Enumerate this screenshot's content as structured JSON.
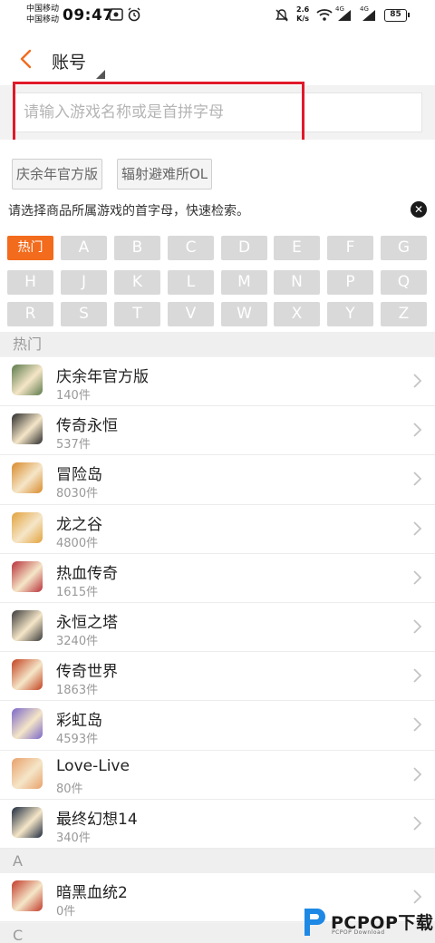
{
  "status_bar": {
    "carrier1": "中国移动",
    "carrier2": "中国移动",
    "time": "09:47",
    "net_speed_value": "2.6",
    "net_speed_unit": "K/s",
    "battery": "85",
    "signal1_label": "4G",
    "signal2_label": "4G"
  },
  "header": {
    "title": "账号"
  },
  "search": {
    "placeholder": "请输入游戏名称或是首拼字母",
    "value": ""
  },
  "recent_chips": [
    "庆余年官方版",
    "辐射避难所OL"
  ],
  "hint": "请选择商品所属游戏的首字母，快速检索。",
  "alphabet": {
    "row1": [
      "热门",
      "A",
      "B",
      "C",
      "D",
      "E",
      "F",
      "G"
    ],
    "row2": [
      "H",
      "J",
      "K",
      "L",
      "M",
      "N",
      "P",
      "Q"
    ],
    "row3": [
      "R",
      "S",
      "T",
      "V",
      "W",
      "X",
      "Y",
      "Z"
    ]
  },
  "sections": {
    "hot": "热门",
    "a": "A",
    "c": "C"
  },
  "hot_games": [
    {
      "name": "庆余年官方版",
      "count": "140件",
      "icon": "qingyunian-icon",
      "color": "#5b7a4a"
    },
    {
      "name": "传奇永恒",
      "count": "537件",
      "icon": "chuanqi-yongheng-icon",
      "color": "#2b2b2b"
    },
    {
      "name": "冒险岛",
      "count": "8030件",
      "icon": "maoxiandao-icon",
      "color": "#d88a2b"
    },
    {
      "name": "龙之谷",
      "count": "4800件",
      "icon": "longzhigu-icon",
      "color": "#e2a23c"
    },
    {
      "name": "热血传奇",
      "count": "1615件",
      "icon": "rexue-chuanqi-icon",
      "color": "#b8303a"
    },
    {
      "name": "永恒之塔",
      "count": "3240件",
      "icon": "yongheng-zhita-icon",
      "color": "#3a3a3a"
    },
    {
      "name": "传奇世界",
      "count": "1863件",
      "icon": "chuanqi-shijie-icon",
      "color": "#c2411f"
    },
    {
      "name": "彩虹岛",
      "count": "4593件",
      "icon": "caihongdao-icon",
      "color": "#7a66c9"
    },
    {
      "name": "Love-Live",
      "count": "80件",
      "icon": "love-live-icon",
      "color": "#e8a06a"
    },
    {
      "name": "最终幻想14",
      "count": "340件",
      "icon": "ff14-icon",
      "color": "#1d2a3f"
    }
  ],
  "a_games": [
    {
      "name": "暗黑血统2",
      "count": "0件",
      "icon": "anhei-xuetong-icon",
      "color": "#c23a2a"
    }
  ],
  "watermark": {
    "text": "PCPOP下载",
    "sub": "PCPOP Download"
  },
  "colors": {
    "accent": "#f36b1c",
    "highlight": "#e0192a",
    "letter_bg": "#d9d9d9"
  }
}
